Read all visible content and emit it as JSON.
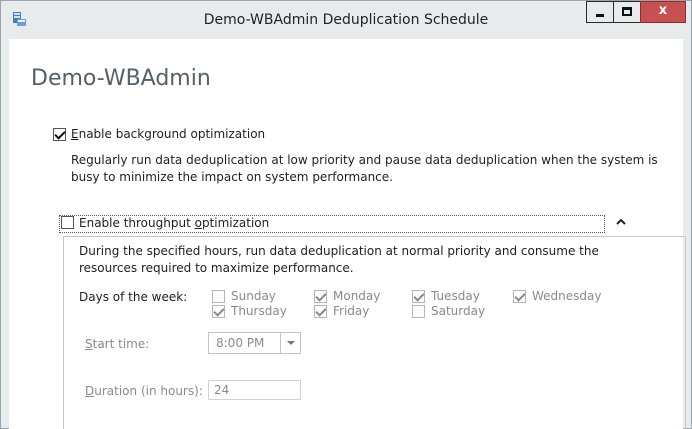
{
  "window": {
    "title": "Demo-WBAdmin Deduplication Schedule",
    "controls": {
      "minimize": "minimize",
      "maximize": "maximize",
      "close": "x"
    }
  },
  "page_title": "Demo-WBAdmin",
  "background_optimization": {
    "label_prefix": "",
    "label_accel": "E",
    "label_rest": "nable background optimization",
    "checked": true,
    "description_line1": "Regularly run data deduplication at low priority and pause data deduplication when the system is",
    "description_line2": "busy to minimize the impact on system performance."
  },
  "throughput_optimization": {
    "label_part1": "Enable throughput ",
    "label_accel": "o",
    "label_part2": "ptimization",
    "checked": false,
    "description_line1": "During the specified hours, run data deduplication at normal priority and consume the",
    "description_line2": "resources required to maximize performance.",
    "days_label": "Days of the week:",
    "days": [
      {
        "name": "Sunday",
        "checked": false
      },
      {
        "name": "Monday",
        "checked": true
      },
      {
        "name": "Tuesday",
        "checked": true
      },
      {
        "name": "Wednesday",
        "checked": true
      },
      {
        "name": "Thursday",
        "checked": true
      },
      {
        "name": "Friday",
        "checked": true
      },
      {
        "name": "Saturday",
        "checked": false
      }
    ],
    "start_time_label_accel": "S",
    "start_time_label_rest": "tart time:",
    "start_time_value": "8:00 PM",
    "duration_label_accel": "D",
    "duration_label_rest": "uration (in hours):",
    "duration_value": "24"
  },
  "colors": {
    "titlebar": "#e8ebec",
    "close_button": "#c75050",
    "page_title": "#555f66",
    "disabled_text": "#8a8a8a"
  },
  "icons": [
    "app-icon",
    "minimize-icon",
    "maximize-icon",
    "close-icon",
    "chevron-up-icon",
    "dropdown-arrow-icon",
    "checkmark-icon"
  ]
}
